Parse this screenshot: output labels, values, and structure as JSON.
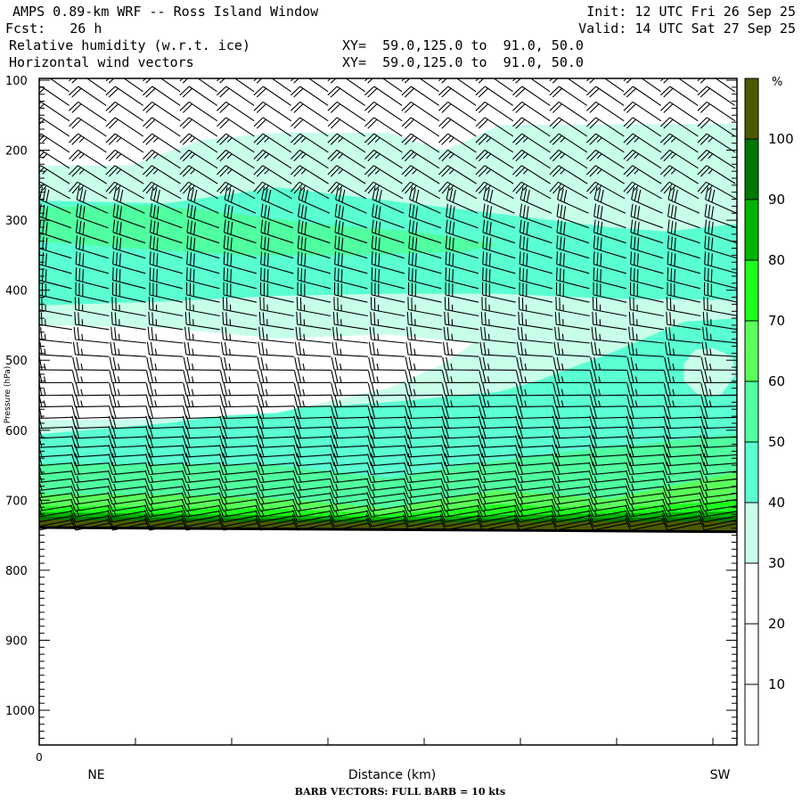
{
  "header": {
    "title": "AMPS 0.89-km WRF -- Ross Island Window",
    "forecast": "Fcst:   26 h",
    "init": "Init: 12 UTC Fri 26 Sep 25",
    "valid": "Valid: 14 UTC Sat 27 Sep 25",
    "field1": "Relative humidity (w.r.t. ice)",
    "field2": "Horizontal wind vectors",
    "xy1": "XY=  59.0,125.0 to  91.0, 50.0",
    "xy2": "XY=  59.0,125.0 to  91.0, 50.0"
  },
  "chart_data": {
    "type": "heatmap",
    "title": "Relative humidity (w.r.t. ice) with horizontal wind barbs",
    "xlabel": "Distance (km)",
    "x_start_label": "0",
    "x_left_label": "NE",
    "x_right_label": "SW",
    "ylabel": "Pressure (hPa)",
    "ylim": [
      1050,
      100
    ],
    "yticks": [
      "100",
      "200",
      "300",
      "400",
      "500",
      "600",
      "700",
      "800",
      "900",
      "1000"
    ],
    "ytick_values": [
      100,
      200,
      300,
      400,
      500,
      600,
      700,
      800,
      900,
      1000
    ],
    "x_columns": 19,
    "footer": "BARB VECTORS:  FULL BARB = 10 kts",
    "colorbar": {
      "unit": "%",
      "labels": [
        "100",
        "90",
        "80",
        "70",
        "60",
        "50",
        "40",
        "30",
        "20",
        "10"
      ],
      "classes": [
        {
          "range": ">100",
          "color": "#4b5a00"
        },
        {
          "range": "90-100",
          "color": "#007800"
        },
        {
          "range": "80-90",
          "color": "#00b400"
        },
        {
          "range": "70-80",
          "color": "#1eff1e"
        },
        {
          "range": "60-70",
          "color": "#5aff5a"
        },
        {
          "range": "50-60",
          "color": "#50ffa0"
        },
        {
          "range": "40-50",
          "color": "#5affd2"
        },
        {
          "range": "30-40",
          "color": "#c8ffe8"
        },
        {
          "range": "20-30",
          "color": "#ffffff"
        },
        {
          "range": "10-20",
          "color": "#ffffff"
        },
        {
          "range": "0-10",
          "color": "#ffffff"
        }
      ]
    },
    "surface_pressure": [
      [
        0,
        739
      ],
      [
        18,
        745
      ]
    ],
    "rh_regions": [
      {
        "class": "30-40",
        "points": [
          [
            -0.5,
            222
          ],
          [
            2,
            222
          ],
          [
            4,
            185
          ],
          [
            6,
            175
          ],
          [
            9,
            175
          ],
          [
            10.5,
            200
          ],
          [
            11.2,
            185
          ],
          [
            12,
            164
          ],
          [
            18.5,
            162
          ],
          [
            18.5,
            760
          ],
          [
            -0.5,
            760
          ]
        ]
      },
      {
        "class": "40-50",
        "points": [
          [
            -0.5,
            272
          ],
          [
            3,
            276
          ],
          [
            6,
            253
          ],
          [
            9,
            272
          ],
          [
            12,
            291
          ],
          [
            15,
            310
          ],
          [
            16.5,
            316
          ],
          [
            18.5,
            305
          ],
          [
            18.5,
            760
          ],
          [
            -0.5,
            760
          ]
        ]
      },
      {
        "class": "50-60",
        "points": [
          [
            -0.5,
            282
          ],
          [
            2,
            278
          ],
          [
            4,
            285
          ],
          [
            7,
            305
          ],
          [
            10,
            318
          ],
          [
            12,
            335
          ],
          [
            11,
            345
          ],
          [
            8,
            350
          ],
          [
            5,
            350
          ],
          [
            2,
            340
          ],
          [
            -0.5,
            330
          ]
        ]
      },
      {
        "class": "30-40",
        "points": [
          [
            -0.5,
            422
          ],
          [
            3,
            416
          ],
          [
            6,
            408
          ],
          [
            9,
            405
          ],
          [
            12,
            405
          ],
          [
            15,
            412
          ],
          [
            18.5,
            414
          ],
          [
            18.5,
            440
          ],
          [
            17,
            445
          ],
          [
            15,
            490
          ],
          [
            13,
            530
          ],
          [
            12,
            545
          ],
          [
            9,
            560
          ],
          [
            6,
            570
          ],
          [
            3,
            590
          ],
          [
            -0.5,
            606
          ]
        ]
      },
      {
        "class": "20-30",
        "points": [
          [
            -0.5,
            450
          ],
          [
            3,
            454
          ],
          [
            6,
            469
          ],
          [
            9,
            463
          ],
          [
            11.3,
            475
          ],
          [
            10.5,
            505
          ],
          [
            9,
            540
          ],
          [
            6,
            575
          ],
          [
            3,
            584
          ],
          [
            -0.5,
            586
          ]
        ]
      },
      {
        "class": "30-40",
        "points": [
          [
            17,
            505
          ],
          [
            17.3,
            485
          ],
          [
            17.8,
            483
          ],
          [
            18.3,
            495
          ],
          [
            18.4,
            520
          ],
          [
            18,
            550
          ],
          [
            17.4,
            550
          ],
          [
            17,
            530
          ]
        ]
      },
      {
        "class": "50-60",
        "points": [
          [
            -0.5,
            647
          ],
          [
            6,
            650
          ],
          [
            9,
            668
          ],
          [
            11,
            650
          ],
          [
            14,
            630
          ],
          [
            18.5,
            605
          ],
          [
            18.5,
            760
          ],
          [
            -0.5,
            760
          ]
        ]
      },
      {
        "class": "60-70",
        "points": [
          [
            -0.5,
            692
          ],
          [
            3,
            692
          ],
          [
            6,
            698
          ],
          [
            9,
            711
          ],
          [
            12,
            686
          ],
          [
            15,
            698
          ],
          [
            18.5,
            660
          ],
          [
            18.5,
            760
          ],
          [
            -0.5,
            760
          ]
        ]
      },
      {
        "class": "70-80",
        "points": [
          [
            -0.5,
            708
          ],
          [
            6,
            712
          ],
          [
            9,
            720
          ],
          [
            12,
            706
          ],
          [
            15,
            712
          ],
          [
            18.5,
            700
          ],
          [
            18.5,
            760
          ],
          [
            -0.5,
            760
          ]
        ]
      },
      {
        "class": "80-90",
        "points": [
          [
            -0.5,
            717
          ],
          [
            9,
            724
          ],
          [
            18.5,
            716
          ],
          [
            18.5,
            760
          ],
          [
            -0.5,
            760
          ]
        ]
      },
      {
        "class": "90-100",
        "points": [
          [
            -0.5,
            723
          ],
          [
            9,
            728
          ],
          [
            18.5,
            724
          ],
          [
            18.5,
            760
          ],
          [
            -0.5,
            760
          ]
        ]
      },
      {
        "class": ">100",
        "points": [
          [
            -0.5,
            728
          ],
          [
            9,
            732
          ],
          [
            18.5,
            730
          ],
          [
            18.5,
            760
          ],
          [
            -0.5,
            760
          ]
        ]
      }
    ],
    "wind_levels_hpa": [
      108,
      128,
      150,
      172,
      195,
      218,
      240,
      262,
      284,
      306,
      328,
      350,
      372,
      394,
      414,
      434,
      454,
      474,
      494,
      514,
      532,
      550,
      566,
      582,
      596,
      610,
      623,
      636,
      648,
      660,
      671,
      682,
      692,
      701,
      710,
      718,
      725,
      731,
      736
    ],
    "wind_profile": [
      {
        "p": 100,
        "staff_angle_deg": 35,
        "speed_kts": 20
      },
      {
        "p": 250,
        "staff_angle_deg": 32,
        "speed_kts": 25
      },
      {
        "p": 300,
        "staff_angle_deg": 20,
        "speed_kts": 30
      },
      {
        "p": 400,
        "staff_angle_deg": 14,
        "speed_kts": 30
      },
      {
        "p": 460,
        "staff_angle_deg": 8,
        "speed_kts": 25
      },
      {
        "p": 520,
        "staff_angle_deg": 0,
        "speed_kts": 25
      },
      {
        "p": 620,
        "staff_angle_deg": -3,
        "speed_kts": 20
      },
      {
        "p": 700,
        "staff_angle_deg": -8,
        "speed_kts": 15
      },
      {
        "p": 740,
        "staff_angle_deg": -12,
        "speed_kts": 10
      }
    ]
  }
}
